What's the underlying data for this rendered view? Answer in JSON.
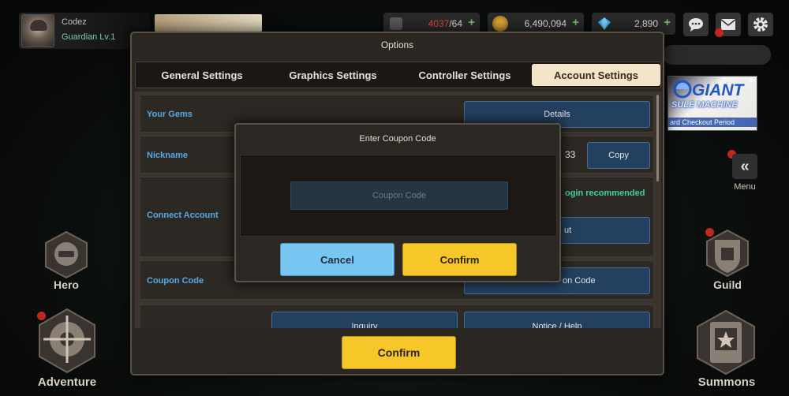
{
  "profile": {
    "name": "Codez",
    "level": "Guardian Lv.1"
  },
  "currencies": {
    "stamina": {
      "current": "4037",
      "max": "/64",
      "icon": "coffee-cup-icon",
      "color": "#e14b3f"
    },
    "gold": {
      "value": "6,490,094",
      "icon": "gold-coin-icon"
    },
    "gems": {
      "value": "2,890",
      "icon": "diamond-gem-icon"
    },
    "plus_symbol": "+"
  },
  "top_buttons": {
    "chat_icon": "chat-bubble-icon",
    "mail_icon": "envelope-icon",
    "settings_icon": "gear-icon"
  },
  "side_banner": {
    "title": "GIANT",
    "subtitle": "SULE MACHINE",
    "period": "ard Checkout Period"
  },
  "menu": {
    "label": "Menu",
    "icon_glyph": "«"
  },
  "nav": {
    "hero": "Hero",
    "adventure": "Adventure",
    "guild": "Guild",
    "summons": "Summons"
  },
  "options": {
    "title": "Options",
    "tabs": [
      {
        "label": "General Settings"
      },
      {
        "label": "Graphics Settings"
      },
      {
        "label": "Controller Settings"
      },
      {
        "label": "Account Settings",
        "active": true
      }
    ],
    "rows": {
      "gems": {
        "label": "Your Gems",
        "button": "Details"
      },
      "nickname": {
        "label": "Nickname",
        "id_partial": "33",
        "button": "Copy"
      },
      "connect": {
        "label": "Connect Account",
        "note": "ogin recommended",
        "button_partial": "ut"
      },
      "coupon": {
        "label": "Coupon Code",
        "button_partial": "on Code"
      },
      "support": {
        "button_left": "Inquiry",
        "button_right": "Notice / Help"
      }
    },
    "confirm": "Confirm"
  },
  "coupon_dialog": {
    "title": "Enter Coupon Code",
    "input_placeholder": "Coupon Code",
    "input_value": "",
    "cancel": "Cancel",
    "confirm": "Confirm"
  },
  "colors": {
    "accent_yellow": "#f7c72a",
    "accent_blue": "#77c6f2",
    "label_blue": "#58a8e8",
    "teal": "#3fd1a3",
    "notification_red": "#c0281f"
  }
}
